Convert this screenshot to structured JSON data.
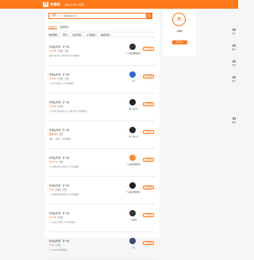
{
  "header": {
    "logo_text": "齐家网",
    "logo_mark": "齐",
    "tagline": "在线人才 找人才招聘"
  },
  "search": {
    "category": "全部",
    "placeholder": "搜索职位/公司"
  },
  "tabs": [
    {
      "label": "最新职位"
    },
    {
      "label": "最热职位"
    }
  ],
  "filters": [
    {
      "label": "城市要求"
    },
    {
      "label": "学历"
    },
    {
      "label": "薪资待遇"
    },
    {
      "label": "公司规模"
    },
    {
      "label": "融资阶段"
    }
  ],
  "jobs": [
    {
      "title": "外贸业务员 【广州】",
      "salary": "4.5-8k",
      "tags": [
        "1-3年",
        "大专"
      ],
      "company_line": "新疆乌鲁木齐·计算机软件·不需要融资",
      "company": "广州英途网络科技",
      "apply": "立即沟通",
      "logo_color": "#333"
    },
    {
      "title": "外贸业务员 【广州】",
      "salary": "3-4.5k",
      "tags": [
        "1-3年",
        "大专"
      ],
      "company_line": "广州XXX有限公司·不需要融资",
      "company": "广州",
      "apply": "立即沟通",
      "logo_color": "#2b6cd4"
    },
    {
      "title": "外贸业务员 【广州】",
      "salary": "4.5-6k",
      "tags": [
        "1-3年"
      ],
      "company_line": "广州国际贸易有限公司·计算机软件·不需要融资",
      "company": "集工业公司",
      "apply": "立即沟通",
      "logo_color": "#222"
    },
    {
      "title": "外贸业务员 【广州】",
      "salary": "面议(薪)",
      "tags": [
        "大专"
      ],
      "company_line": "网络 · 计算机 · 不需要融资",
      "company": "新工业公司",
      "apply": "立即沟通",
      "logo_color": "#2a2a2a"
    },
    {
      "title": "外贸业务员 【广州】",
      "salary": "3k-4.5k",
      "tags": [
        "大专"
      ],
      "company_line": "广州贸易进出口有限公司·不需要融资",
      "company": "广州英途网络科技",
      "apply": "立即沟通",
      "logo_color": "#ff8a3a"
    },
    {
      "title": "外贸业务员 【广州】",
      "salary": "4-9k",
      "tags": [
        "1-3年",
        "大专"
      ],
      "company_line": "广州英国际贸易有限公司·不需要融资",
      "company": "广州英途网络科技有限公司",
      "apply": "立即沟通",
      "logo_color": "#1e1e1e"
    },
    {
      "title": "外贸业务员 【广州】",
      "salary": "3.5-6k",
      "tags": [
        "1-3年"
      ],
      "company_line": "广州进出口有限公司·不需要融资",
      "company": "广州英途",
      "apply": "立即沟通",
      "logo_color": "#333"
    },
    {
      "title": "外贸业务员 【广州】",
      "salary": "4.5k",
      "tags": [
        "1-3年"
      ],
      "company_line": "广州·外贸·不需要融资",
      "company": "广州",
      "apply": "立即沟通",
      "logo_color": "#3a4a7a"
    }
  ],
  "sidebar": {
    "avatar_text": "齐",
    "name": "齐家网",
    "button": "发布职位"
  },
  "rightbar": [
    {
      "label": "首页"
    },
    {
      "label": "职位"
    },
    {
      "label": "消息"
    },
    {
      "label": "我的"
    },
    {
      "label": "客服"
    }
  ]
}
